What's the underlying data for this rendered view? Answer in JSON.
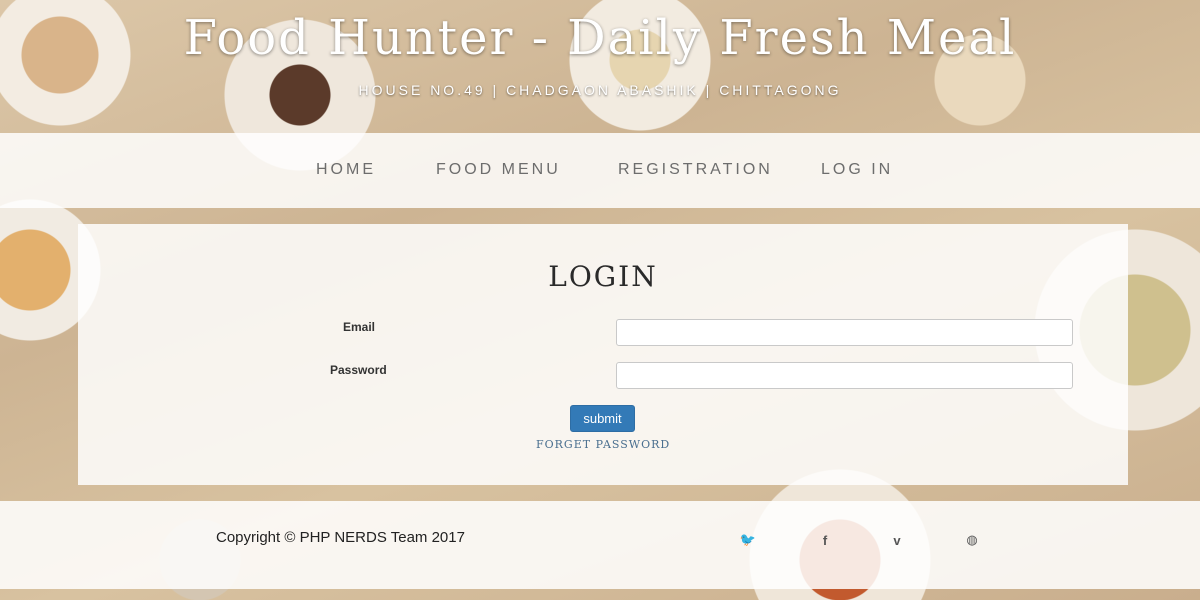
{
  "header": {
    "title": "Food Hunter - Daily Fresh Meal",
    "address": "HOUSE NO.49 | CHADGAON ABASHIK | CHITTAGONG"
  },
  "nav": {
    "items": [
      {
        "label": "HOME"
      },
      {
        "label": "FOOD MENU"
      },
      {
        "label": "REGISTRATION"
      },
      {
        "label": "LOG IN"
      }
    ]
  },
  "login": {
    "title": "LOGIN",
    "email_label": "Email",
    "email_value": "",
    "password_label": "Password",
    "password_value": "",
    "submit_label": "submit",
    "forget_label": "FORGET PASSWORD"
  },
  "footer": {
    "copyright": "Copyright © PHP NERDS Team 2017",
    "social": [
      {
        "icon": "twitter-icon",
        "glyph": "🐦"
      },
      {
        "icon": "facebook-icon",
        "glyph": "f"
      },
      {
        "icon": "vimeo-icon",
        "glyph": "v"
      },
      {
        "icon": "dribbble-icon",
        "glyph": "◍"
      }
    ]
  },
  "colors": {
    "accent": "#337ab7",
    "link": "#4a6f8f"
  }
}
